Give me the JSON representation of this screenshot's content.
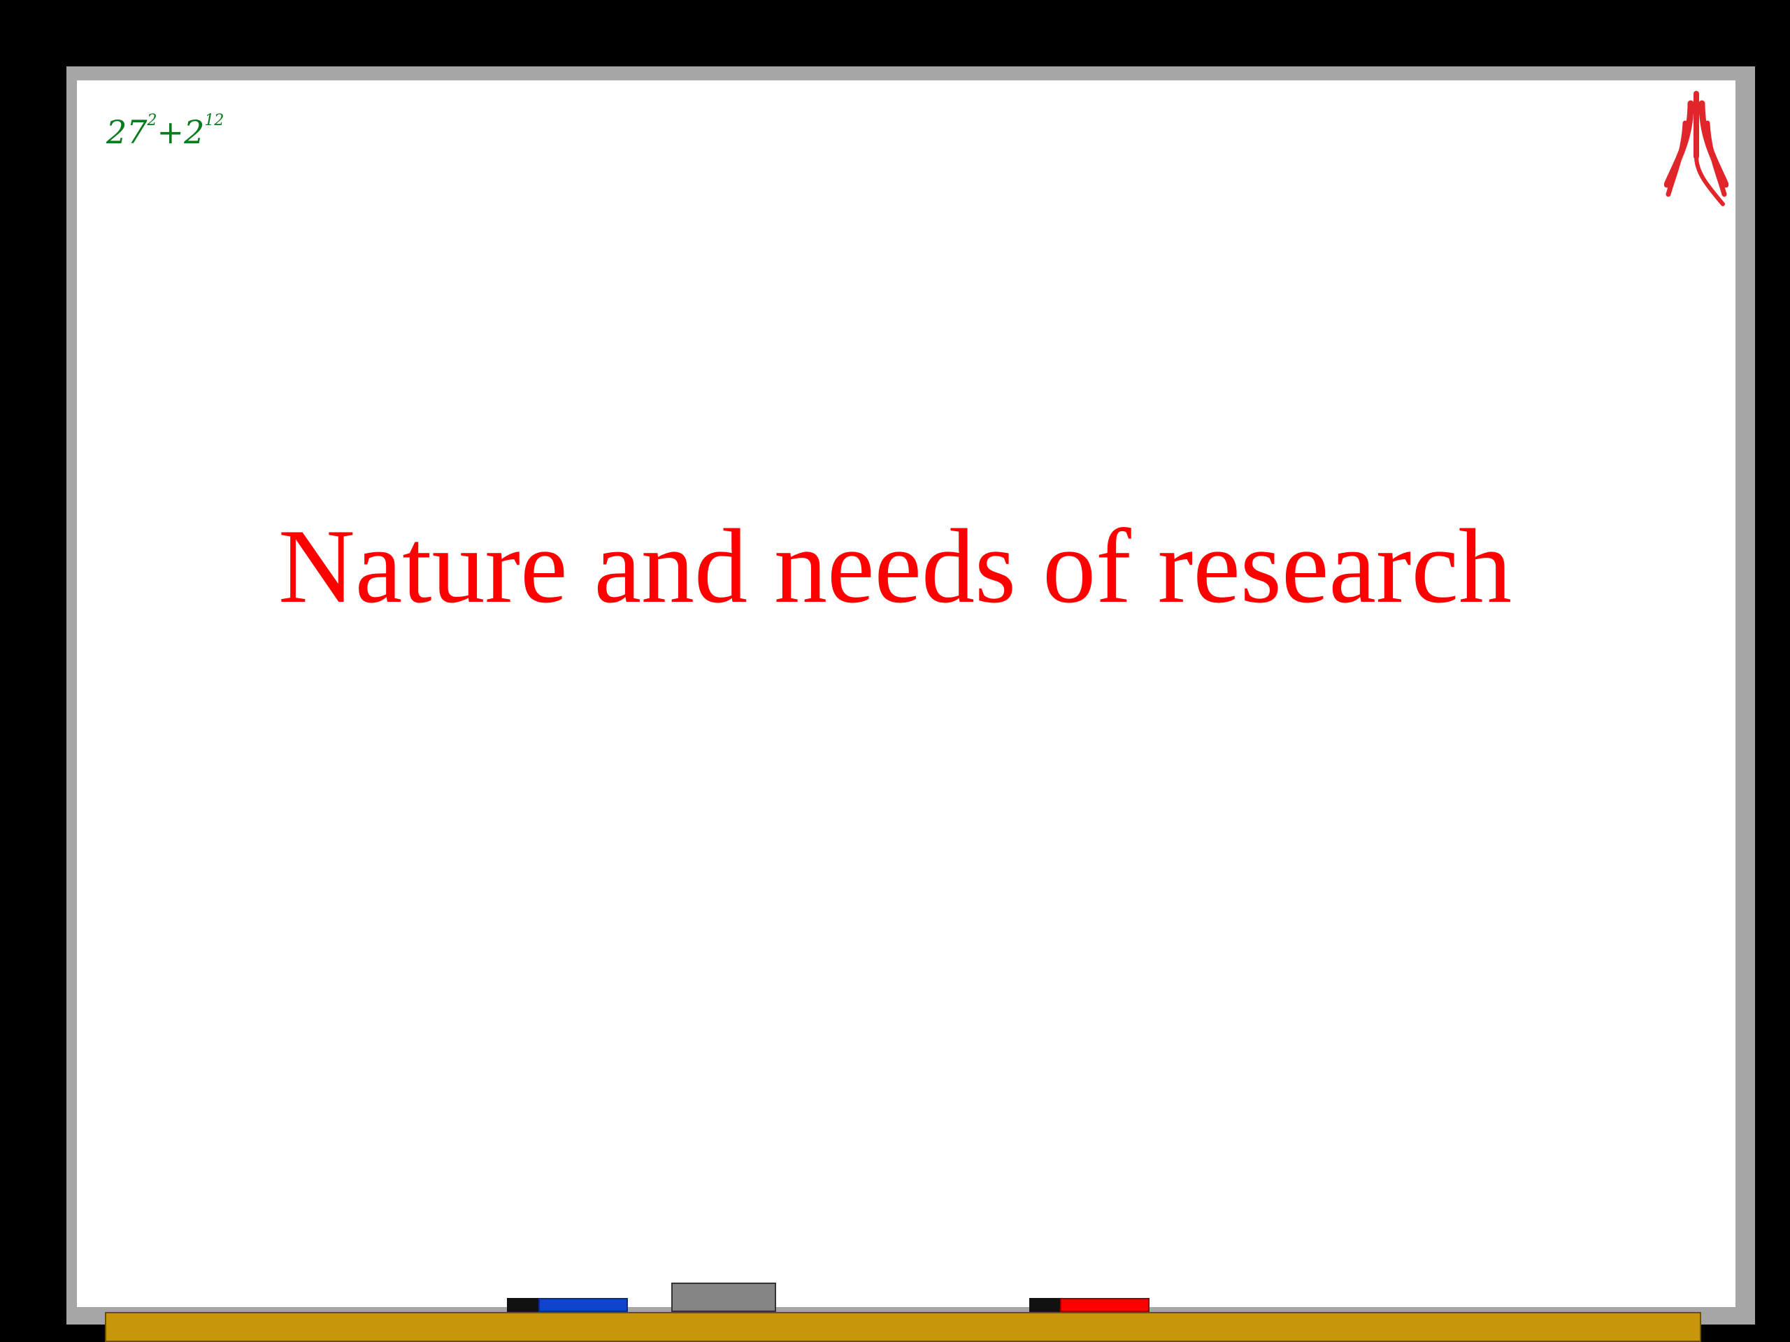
{
  "slide": {
    "title": "Nature and needs of research",
    "formula": {
      "base1": "27",
      "exp1": "2",
      "op": "+",
      "base2": "2",
      "exp2": "12"
    }
  },
  "colors": {
    "background": "#000000",
    "board_frame": "#a6a6a6",
    "board_surface": "#ffffff",
    "title": "#ff0000",
    "formula": "#0a7a1e",
    "logo": "#e0262a",
    "tray": "#c8960a",
    "blue_marker": "#1144cc",
    "red_marker": "#ff0000",
    "eraser": "#858585"
  },
  "icons": {
    "logo": "institute-logo-icon",
    "blue_marker": "blue-marker-icon",
    "red_marker": "red-marker-icon",
    "eraser": "eraser-icon"
  }
}
